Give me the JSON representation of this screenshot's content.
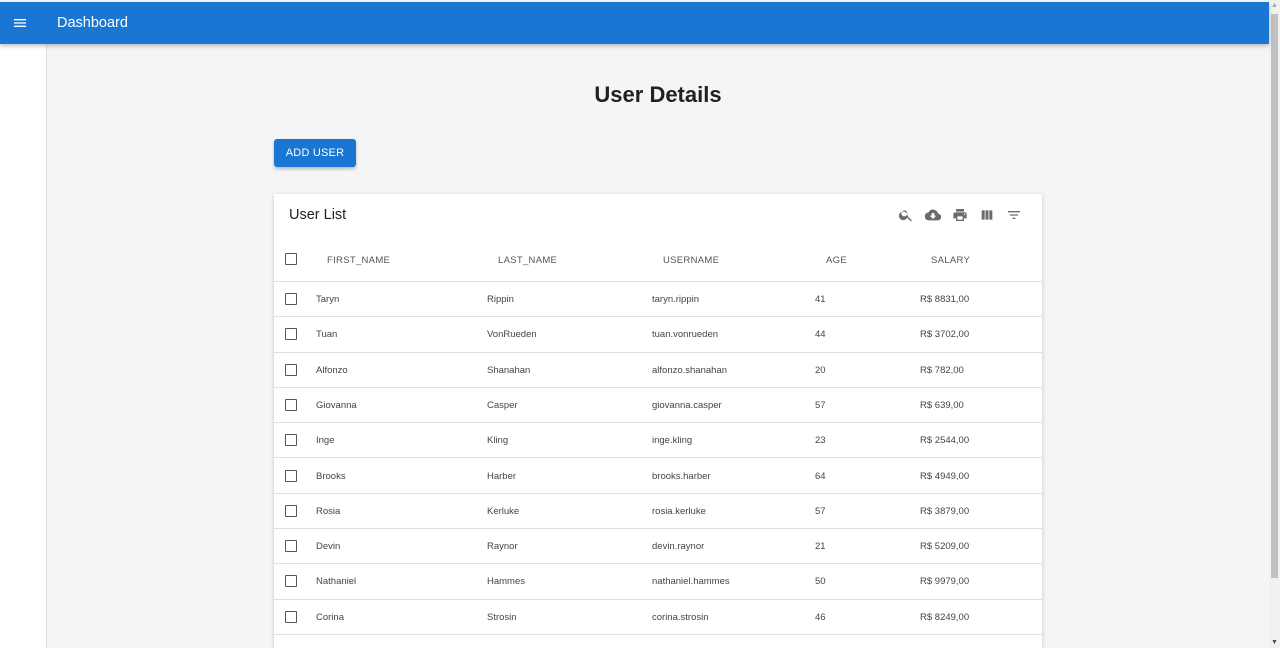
{
  "appbar": {
    "title": "Dashboard",
    "menu_icon": "hamburger-menu-icon",
    "color": "#1976d2"
  },
  "page": {
    "title": "User Details"
  },
  "actions": {
    "add_user_label": "ADD USER"
  },
  "table": {
    "title": "User List",
    "toolbar_icons": [
      "search-icon",
      "cloud-download-icon",
      "print-icon",
      "view-columns-icon",
      "filter-icon"
    ],
    "columns": [
      "FIRST_NAME",
      "LAST_NAME",
      "USERNAME",
      "AGE",
      "SALARY"
    ],
    "rows": [
      {
        "first_name": "Taryn",
        "last_name": "Rippin",
        "username": "taryn.rippin",
        "age": "41",
        "salary": "R$ 8831,00"
      },
      {
        "first_name": "Tuan",
        "last_name": "VonRueden",
        "username": "tuan.vonrueden",
        "age": "44",
        "salary": "R$ 3702,00"
      },
      {
        "first_name": "Alfonzo",
        "last_name": "Shanahan",
        "username": "alfonzo.shanahan",
        "age": "20",
        "salary": "R$ 782,00"
      },
      {
        "first_name": "Giovanna",
        "last_name": "Casper",
        "username": "giovanna.casper",
        "age": "57",
        "salary": "R$ 639,00"
      },
      {
        "first_name": "Inge",
        "last_name": "Kling",
        "username": "inge.kling",
        "age": "23",
        "salary": "R$ 2544,00"
      },
      {
        "first_name": "Brooks",
        "last_name": "Harber",
        "username": "brooks.harber",
        "age": "64",
        "salary": "R$ 4949,00"
      },
      {
        "first_name": "Rosia",
        "last_name": "Kerluke",
        "username": "rosia.kerluke",
        "age": "57",
        "salary": "R$ 3879,00"
      },
      {
        "first_name": "Devin",
        "last_name": "Raynor",
        "username": "devin.raynor",
        "age": "21",
        "salary": "R$ 5209,00"
      },
      {
        "first_name": "Nathaniel",
        "last_name": "Hammes",
        "username": "nathaniel.hammes",
        "age": "50",
        "salary": "R$ 9979,00"
      },
      {
        "first_name": "Corina",
        "last_name": "Strosin",
        "username": "corina.strosin",
        "age": "46",
        "salary": "R$ 8249,00"
      }
    ]
  }
}
